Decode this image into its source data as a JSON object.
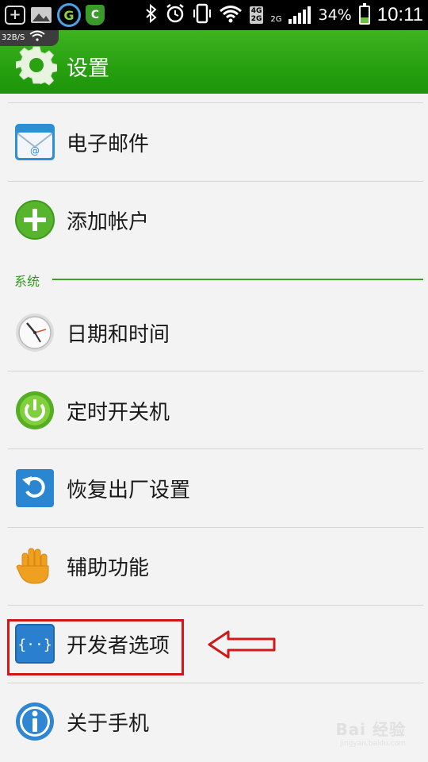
{
  "status_bar": {
    "net_4g": "4G",
    "net_2g_top": "2G",
    "net_2g": "2G",
    "battery_pct": "34%",
    "battery_level": 0.34,
    "time": "10:11",
    "speed": "32B/S",
    "icons": [
      "plus-icon",
      "image-icon",
      "g-app-icon",
      "shield-app-icon",
      "bluetooth-icon",
      "alarm-icon",
      "vibrate-icon",
      "wifi-icon",
      "signal-icon",
      "battery-icon"
    ]
  },
  "action_bar": {
    "title": "设置",
    "icon": "gear-icon"
  },
  "items": [
    {
      "label": "电子邮件",
      "icon": "email-icon"
    },
    {
      "label": "添加帐户",
      "icon": "add-icon"
    },
    {
      "label": "日期和时间",
      "icon": "clock-icon"
    },
    {
      "label": "定时开关机",
      "icon": "power-icon"
    },
    {
      "label": "恢复出厂设置",
      "icon": "reset-icon"
    },
    {
      "label": "辅助功能",
      "icon": "hand-icon"
    },
    {
      "label": "开发者选项",
      "icon": "developer-icon"
    },
    {
      "label": "关于手机",
      "icon": "info-icon"
    }
  ],
  "section": {
    "label": "系统"
  },
  "watermark": {
    "brand": "Bai 经验",
    "url": "jingyan.baidu.com"
  },
  "colors": {
    "accent_green": "#27a010",
    "highlight_red": "#d01818"
  }
}
